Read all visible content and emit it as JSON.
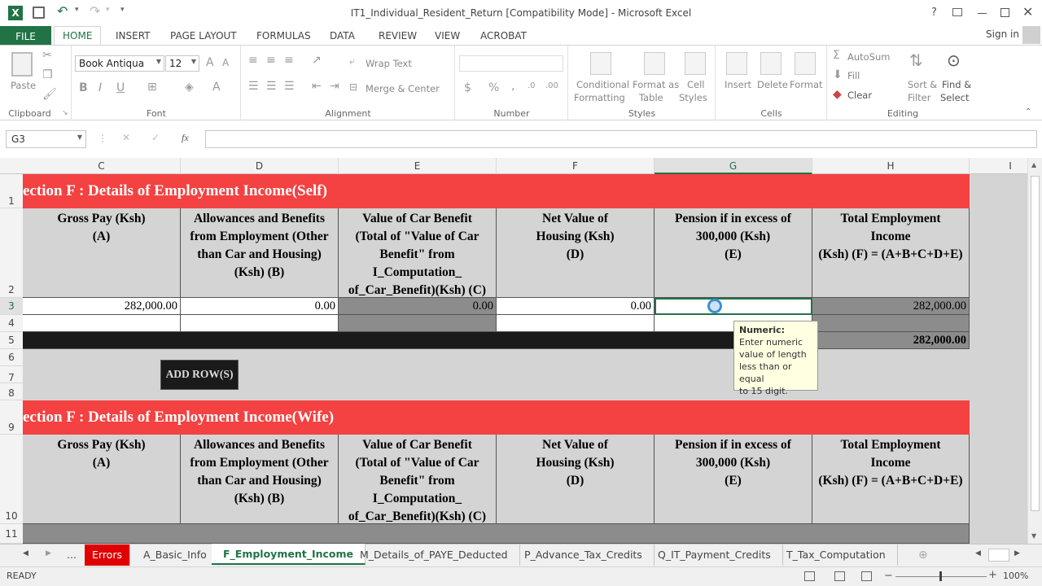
{
  "window": {
    "title": "IT1_Individual_Resident_Return  [Compatibility Mode] - Microsoft Excel",
    "help": "?",
    "sign_in": "Sign in"
  },
  "ribbon_tabs": [
    "FILE",
    "HOME",
    "INSERT",
    "PAGE LAYOUT",
    "FORMULAS",
    "DATA",
    "REVIEW",
    "VIEW",
    "ACROBAT"
  ],
  "ribbon": {
    "clipboard": {
      "label": "Clipboard",
      "paste": "Paste"
    },
    "font": {
      "label": "Font",
      "name": "Book Antiqua",
      "size": "12",
      "bold": "B",
      "italic": "I",
      "underline": "U"
    },
    "alignment": {
      "label": "Alignment",
      "wrap": "Wrap Text",
      "merge": "Merge & Center"
    },
    "number": {
      "label": "Number",
      "currency": "$",
      "percent": "%"
    },
    "styles": {
      "label": "Styles",
      "cond1": "Conditional",
      "cond2": "Formatting",
      "fmt1": "Format as",
      "fmt2": "Table",
      "cell1": "Cell",
      "cell2": "Styles"
    },
    "cells": {
      "label": "Cells",
      "insert": "Insert",
      "delete": "Delete",
      "format": "Format"
    },
    "editing": {
      "label": "Editing",
      "autosum": "AutoSum",
      "fill": "Fill",
      "clear": "Clear",
      "sort1": "Sort &",
      "sort2": "Filter",
      "find1": "Find &",
      "find2": "Select"
    }
  },
  "formula_bar": {
    "name_box": "G3",
    "fx": "fx",
    "formula": ""
  },
  "columns": [
    "C",
    "D",
    "E",
    "F",
    "G",
    "H",
    "I"
  ],
  "rows": [
    "1",
    "2",
    "3",
    "4",
    "5",
    "6",
    "7",
    "8",
    "9",
    "10",
    "11"
  ],
  "section_self": "ection F : Details of Employment Income(Self)",
  "section_wife": "ection F : Details of Employment Income(Wife)",
  "headers": [
    [
      "Gross Pay (Ksh)",
      "(A)"
    ],
    [
      "Allowances and Benefits",
      "from Employment (Other",
      "than Car and Housing)",
      "(Ksh) (B)"
    ],
    [
      "Value of Car Benefit",
      "(Total of \"Value of Car",
      "Benefit\" from",
      "I_Computation_",
      "of_Car_Benefit)(Ksh) (C)"
    ],
    [
      "Net Value of",
      "Housing (Ksh)",
      "(D)"
    ],
    [
      "Pension if in excess of",
      "300,000 (Ksh)",
      "(E)"
    ],
    [
      "Total Employment",
      "Income",
      "(Ksh) (F) = (A+B+C+D+E)"
    ]
  ],
  "row3": [
    "282,000.00",
    "0.00",
    "0.00",
    "0.00",
    "",
    "282,000.00"
  ],
  "row5_total": "282,000.00",
  "add_rows_button": "ADD ROW(S)",
  "tooltip": {
    "title": "Numeric:",
    "body": [
      "Enter numeric",
      "value of length",
      "less than or equal",
      "to 15 digit."
    ]
  },
  "sheet_tabs": [
    "...",
    "Errors",
    "A_Basic_Info",
    "F_Employment_Income",
    "M_Details_of_PAYE_Deducted",
    "P_Advance_Tax_Credits",
    "Q_IT_Payment_Credits",
    "T_Tax_Computation"
  ],
  "status": {
    "ready": "READY",
    "zoom": "100%"
  },
  "colors": {
    "excel_green": "#217346",
    "section_red": "#f44141",
    "errors_tab": "#e00000"
  }
}
